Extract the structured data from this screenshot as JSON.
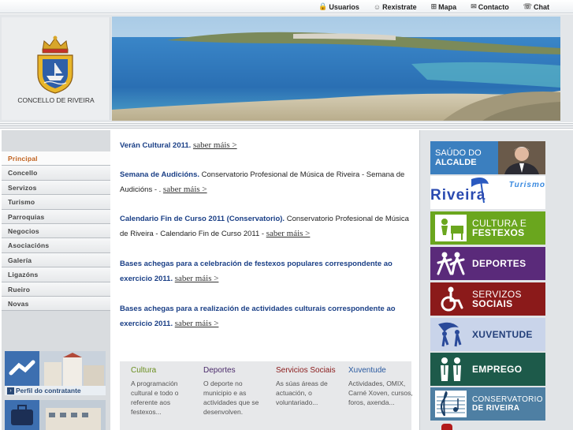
{
  "topnav": [
    {
      "label": "Usuarios",
      "icon": "lock-icon",
      "glyph": "🔒"
    },
    {
      "label": "Rexistrate",
      "icon": "user-icon",
      "glyph": "☺"
    },
    {
      "label": "Mapa",
      "icon": "sitemap-icon",
      "glyph": "⊞"
    },
    {
      "label": "Contacto",
      "icon": "envelope-icon",
      "glyph": "✉"
    },
    {
      "label": "Chat",
      "icon": "chat-icon",
      "glyph": "☏"
    }
  ],
  "header": {
    "logo_text": "CONCELLO DE RIVEIRA"
  },
  "sidebar": {
    "items": [
      {
        "label": "Principal"
      },
      {
        "label": "Concello"
      },
      {
        "label": "Servizos"
      },
      {
        "label": "Turismo"
      },
      {
        "label": "Parroquias"
      },
      {
        "label": "Negocios"
      },
      {
        "label": "Asociacións"
      },
      {
        "label": "Galería"
      },
      {
        "label": "Ligazóns"
      },
      {
        "label": "Rueiro"
      },
      {
        "label": "Novas"
      }
    ],
    "promo_label": "Perfil do contratante"
  },
  "news": [
    {
      "title": "Verán Cultural 2011.",
      "text": "",
      "more": "saber máis >"
    },
    {
      "title": "Semana de Audicións.",
      "text": " Conservatorio Profesional de Música de Riveira - Semana de Audicións - .",
      "more": "saber máis >"
    },
    {
      "title": "Calendario Fin de Curso 2011 (Conservatorio).",
      "text": " Conservatorio Profesional de Música de Riveira - Calendario Fin de Curso 2011 -",
      "more": "saber máis >"
    },
    {
      "title": "Bases achegas para a celebración de festexos populares correspondente ao exercicio 2011.",
      "text": "",
      "more": "saber máis >"
    },
    {
      "title": "Bases achegas para a realización de actividades culturais correspondente ao exercicio 2011.",
      "text": "",
      "more": "saber máis >"
    }
  ],
  "categories": [
    {
      "title": "Cultura",
      "color": "#6a8e1e",
      "desc": "A programación cultural e todo o referente aos festexos..."
    },
    {
      "title": "Deportes",
      "color": "#4a2a6a",
      "desc": "O deporte no municipio e as actividades que se desenvolven."
    },
    {
      "title": "Servicios Sociais",
      "color": "#8a1a1a",
      "desc": "As súas áreas de actuación, o voluntariado..."
    },
    {
      "title": "Xuventude",
      "color": "#2a5aa0",
      "desc": "Actividades, OMIX, Carné Xoven, cursos, foros, axenda..."
    }
  ],
  "right_buttons": [
    {
      "line1": "SAÚDO DO",
      "line2": "ALCALDE",
      "color": "#3b7fbf",
      "icon": "mayor-photo"
    },
    {
      "line1": "Riveira",
      "line2": "Turismo",
      "color": "#ffffff",
      "icon": "turismo-logo"
    },
    {
      "line1": "CULTURA E",
      "line2": "FESTEXOS",
      "color": "#6aa61e",
      "icon": "culture-icon"
    },
    {
      "line1": "DEPORTES",
      "line2": "",
      "color": "#5a2a7a",
      "icon": "sports-icon"
    },
    {
      "line1": "SERVIZOS",
      "line2": "SOCIAIS",
      "color": "#8b1a1a",
      "icon": "social-services-icon"
    },
    {
      "line1": "XUVENTUDE",
      "line2": "",
      "color": "#c9d4ea",
      "icon": "youth-icon"
    },
    {
      "line1": "EMPREGO",
      "line2": "",
      "color": "#1d5a4a",
      "icon": "employment-icon"
    },
    {
      "line1": "CONSERVATORIO",
      "line2": "DE RIVEIRA",
      "color": "#4e7fa3",
      "icon": "music-icon"
    }
  ]
}
